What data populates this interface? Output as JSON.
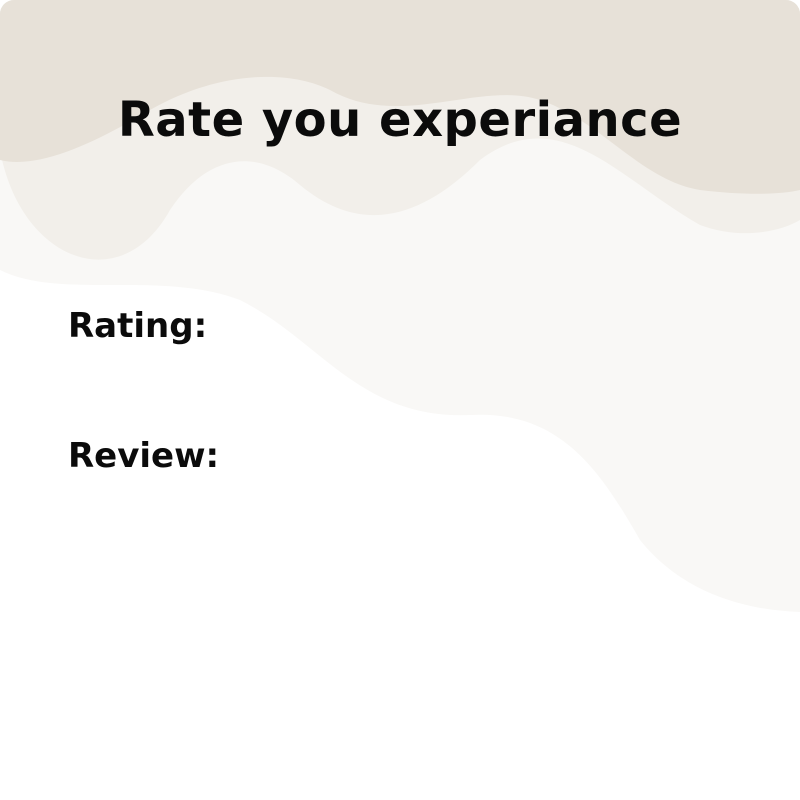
{
  "title": "Rate you experiance",
  "fields": {
    "rating_label": "Rating:",
    "review_label": "Review:"
  },
  "colors": {
    "background": "#ffffff",
    "wave_dark": "#e7e1d8",
    "wave_light": "#f2efea",
    "wave_faint": "#f9f8f6",
    "text": "#0b0b0b"
  }
}
